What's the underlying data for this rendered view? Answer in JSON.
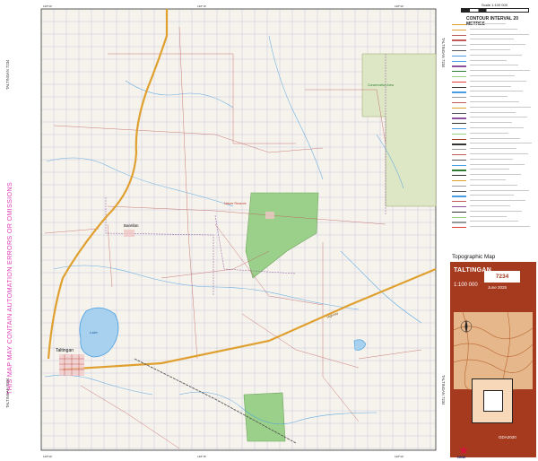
{
  "map": {
    "background": "#f5f3ec",
    "grid_color": "#3b3bb0",
    "road_color": "#e0a030",
    "minor_road_color": "#c25a5a",
    "creek_color": "#4a9de0",
    "park_color": "#9bd08a",
    "labels": {
      "place_major": "Taltingan",
      "place_north": "Barellan",
      "park_name": "Nature Reserve",
      "park_name_east": "Conservation Area",
      "lake": "Lake",
      "highway": "Highway"
    }
  },
  "margins": {
    "disclaimer": "THIS MAP MAY CONTAIN AUTOMATION ERRORS OR OMISSIONS",
    "left_top_sheet": "TALTINGAN 7234",
    "left_bottom_sheet": "TALTINGAN 7234",
    "right_top_sheet": "TALTINGAN 7234",
    "right_bottom_sheet": "TALTINGAN 7234"
  },
  "panel": {
    "scale_label": "Scale 1:100 000",
    "contour_interval": "CONTOUR INTERVAL 20 METRES",
    "topographic_map": "Topographic Map",
    "sheet_name": "TALTINGAN",
    "sheet_scale": "1:100 000",
    "sheet_number": "7234",
    "edition_date": "June 2025",
    "product_code": "GDA2020",
    "agency": "NSW",
    "brown_color": "#a63a1f"
  }
}
